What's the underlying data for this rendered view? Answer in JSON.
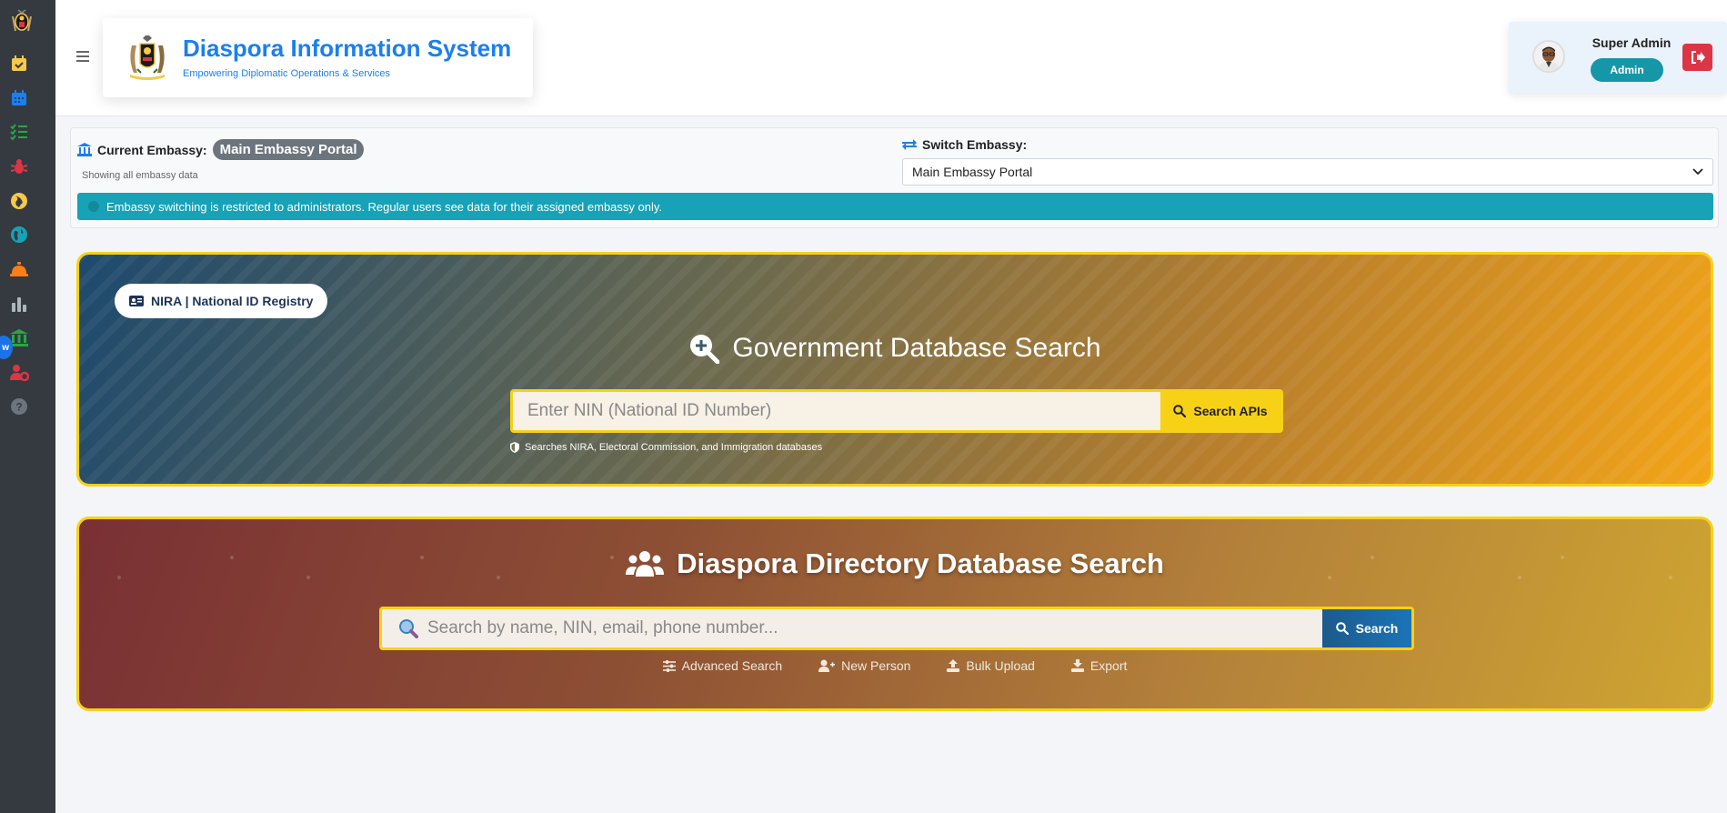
{
  "sidebar": {
    "logo": "coat-of-arms-logo",
    "items": [
      {
        "name": "calendar-check-icon",
        "color": "#f7c948"
      },
      {
        "name": "calendar-icon",
        "color": "#1a7ff0"
      },
      {
        "name": "list-check-icon",
        "color": "#28a745"
      },
      {
        "name": "bug-icon",
        "color": "#dc3545"
      },
      {
        "name": "globe-africa-icon",
        "color": "#f7c948"
      },
      {
        "name": "globe-icon",
        "color": "#17a2b8"
      },
      {
        "name": "concierge-bell-icon",
        "color": "#fd7e14"
      },
      {
        "name": "chart-bar-icon",
        "color": "#adb5bd"
      },
      {
        "name": "bank-icon",
        "color": "#28a745"
      },
      {
        "name": "users-cog-icon",
        "color": "#dc3545"
      },
      {
        "name": "question-circle-icon",
        "color": "#6c757d"
      }
    ],
    "bubble": "w"
  },
  "header": {
    "title": "Diaspora Information System",
    "subtitle": "Empowering Diplomatic Operations & Services",
    "user": {
      "name": "Super Admin",
      "role": "Admin"
    }
  },
  "embassy": {
    "current_label": "Current Embassy:",
    "current_value": "Main Embassy Portal",
    "showing": "Showing all embassy data",
    "switch_label": "Switch Embassy:",
    "selected_option": "Main Embassy Portal",
    "alert": "Embassy switching is restricted to administrators. Regular users see data for their assigned embassy only."
  },
  "gov_search": {
    "badge": "NIRA | National ID Registry",
    "title": "Government Database Search",
    "placeholder": "Enter NIN (National ID Number)",
    "button": "Search APIs",
    "note": "Searches NIRA, Electoral Commission, and Immigration databases"
  },
  "diaspora_search": {
    "title": "Diaspora Directory Database Search",
    "placeholder": "Search by name, NIN, email, phone number...",
    "button": "Search",
    "links": [
      {
        "label": "Advanced Search",
        "icon": "sliders-icon"
      },
      {
        "label": "New Person",
        "icon": "user-plus-icon"
      },
      {
        "label": "Bulk Upload",
        "icon": "upload-icon"
      },
      {
        "label": "Export",
        "icon": "download-icon"
      }
    ]
  },
  "colors": {
    "brand": "#1a7ff0",
    "sidebar": "#343a40",
    "accent_yellow": "#f7d116",
    "info": "#17a2b8",
    "danger": "#dc3545"
  }
}
